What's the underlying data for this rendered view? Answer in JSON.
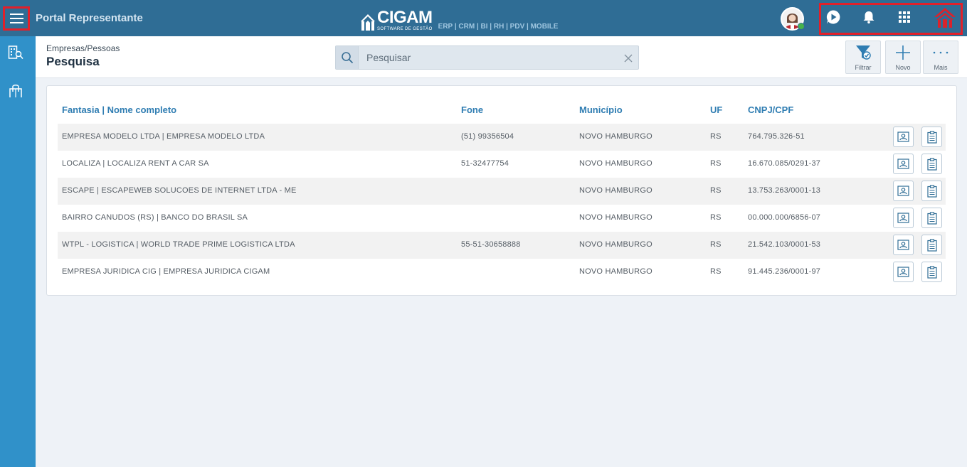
{
  "app": {
    "title": "Portal Representante",
    "logo_word": "CIGAM",
    "logo_sub": "SOFTWARE DE GESTÃO",
    "logo_products": "ERP | CRM | BI | RH | PDV | MOBILE"
  },
  "header": {
    "breadcrumb": "Empresas/Pessoas",
    "title": "Pesquisa",
    "search": {
      "placeholder": "Pesquisar",
      "value": ""
    },
    "tools": {
      "filter": "Filtrar",
      "new": "Novo",
      "more": "Mais"
    }
  },
  "table": {
    "columns": [
      "Fantasia | Nome completo",
      "Fone",
      "Município",
      "UF",
      "CNPJ/CPF"
    ],
    "rows": [
      {
        "name": "EMPRESA MODELO LTDA | EMPRESA MODELO LTDA",
        "phone": "(51) 99356504",
        "city": "NOVO HAMBURGO",
        "uf": "RS",
        "doc": "764.795.326-51"
      },
      {
        "name": "LOCALIZA | LOCALIZA RENT A CAR SA",
        "phone": "51-32477754",
        "city": "NOVO HAMBURGO",
        "uf": "RS",
        "doc": "16.670.085/0291-37"
      },
      {
        "name": "ESCAPE | ESCAPEWEB SOLUCOES DE INTERNET LTDA - ME",
        "phone": "",
        "city": "NOVO HAMBURGO",
        "uf": "RS",
        "doc": "13.753.263/0001-13"
      },
      {
        "name": "BAIRRO CANUDOS (RS) | BANCO DO BRASIL SA",
        "phone": "",
        "city": "NOVO HAMBURGO",
        "uf": "RS",
        "doc": "00.000.000/6856-07"
      },
      {
        "name": "WTPL - LOGISTICA | WORLD TRADE PRIME LOGISTICA LTDA",
        "phone": "55-51-30658888",
        "city": "NOVO HAMBURGO",
        "uf": "RS",
        "doc": "21.542.103/0001-53"
      },
      {
        "name": "EMPRESA JURIDICA CIG | EMPRESA JURIDICA CIGAM",
        "phone": "",
        "city": "NOVO HAMBURGO",
        "uf": "RS",
        "doc": "91.445.236/0001-97"
      }
    ]
  },
  "icons": {
    "menu": "hamburger-menu-icon",
    "play": "play-circle-icon",
    "bell": "bell-icon",
    "apps": "apps-grid-icon",
    "home": "home-icon",
    "contact_card": "contact-card-icon",
    "clipboard": "clipboard-icon"
  },
  "colors": {
    "topbar": "#2f6d95",
    "sidebar": "#3091c9",
    "accent": "#2f7db2",
    "highlight_border": "#e2202a",
    "home_icon": "#d9232d",
    "online": "#46b34b"
  }
}
